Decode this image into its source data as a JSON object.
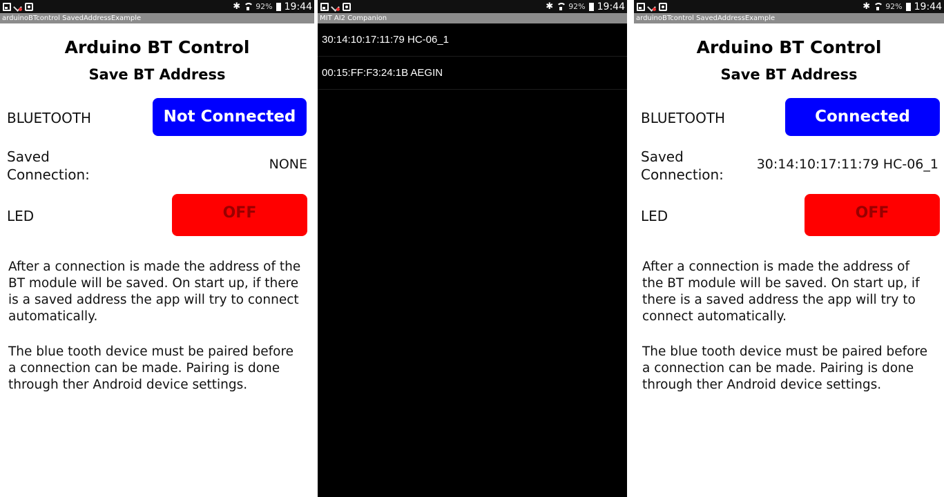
{
  "status_bar": {
    "battery": "92%",
    "clock": "19:44",
    "bluetooth_glyph": "✱"
  },
  "screen_left": {
    "window_title": "arduinoBTcontrol SavedAddressExample",
    "app_title": "Arduino BT Control",
    "app_subtitle": "Save BT Address",
    "bluetooth_label": "BLUETOOTH",
    "bluetooth_button": "Not Connected",
    "saved_label": "Saved Connection:",
    "saved_value": "NONE",
    "led_label": "LED",
    "led_button": "OFF",
    "paragraph1": "After a connection is made the address of the BT module will be saved. On start up, if there is a saved address the app will try to connect automatically.",
    "paragraph2": "The blue tooth device must be paired before a connection can be made. Pairing is done through ther Android device settings."
  },
  "screen_middle": {
    "window_title": "MIT AI2 Companion",
    "devices": [
      "30:14:10:17:11:79 HC-06_1",
      "00:15:FF:F3:24:1B AEGIN"
    ]
  },
  "screen_right": {
    "window_title": "arduinoBTcontrol SavedAddressExample",
    "app_title": "Arduino BT Control",
    "app_subtitle": "Save BT Address",
    "bluetooth_label": "BLUETOOTH",
    "bluetooth_button": "Connected",
    "saved_label": "Saved Connection:",
    "saved_value": "30:14:10:17:11:79 HC-06_1",
    "led_label": "LED",
    "led_button": "OFF",
    "paragraph1": "After a connection is made the address of the BT module will be saved. On start up, if there is a saved address the app will try to connect automatically.",
    "paragraph2": "The blue tooth device must be paired before a connection can be made. Pairing is done through ther Android device settings."
  },
  "colors": {
    "button_blue": "#0000ff",
    "button_red": "#ff0000",
    "led_text": "#990000",
    "title_bar": "#8c8c8c"
  },
  "icons": [
    "screenshot-icon",
    "missed-call-icon",
    "photo-icon",
    "bluetooth-icon",
    "wifi-icon",
    "battery-icon"
  ]
}
